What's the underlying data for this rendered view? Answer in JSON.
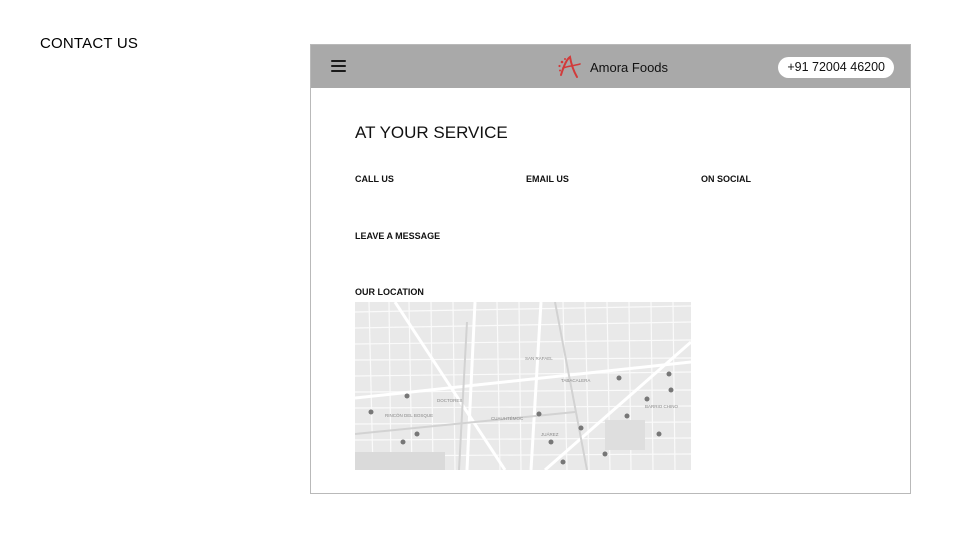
{
  "slide": {
    "title": "CONTACT US"
  },
  "header": {
    "menu_icon": "hamburger-menu-icon",
    "logo_icon": "amora-logo-icon",
    "brand_name": "Amora Foods",
    "phone": "+91 72004 46200",
    "bar_color": "#a9a9a9",
    "logo_color": "#d23a3a"
  },
  "main": {
    "heading": "AT YOUR SERVICE",
    "contact_options": {
      "call": "CALL US",
      "email": "EMAIL US",
      "social": "ON SOCIAL"
    },
    "message_label": "LEAVE A MESSAGE",
    "location_label": "OUR LOCATION",
    "map": {
      "labels": [
        "SAN RAFAEL",
        "TABACALERA",
        "JUÁREZ",
        "CUAUHTÉMOC",
        "BARRIO CHINO",
        "RINCÓN DEL BOSQUE",
        "DOCTORES"
      ]
    }
  }
}
